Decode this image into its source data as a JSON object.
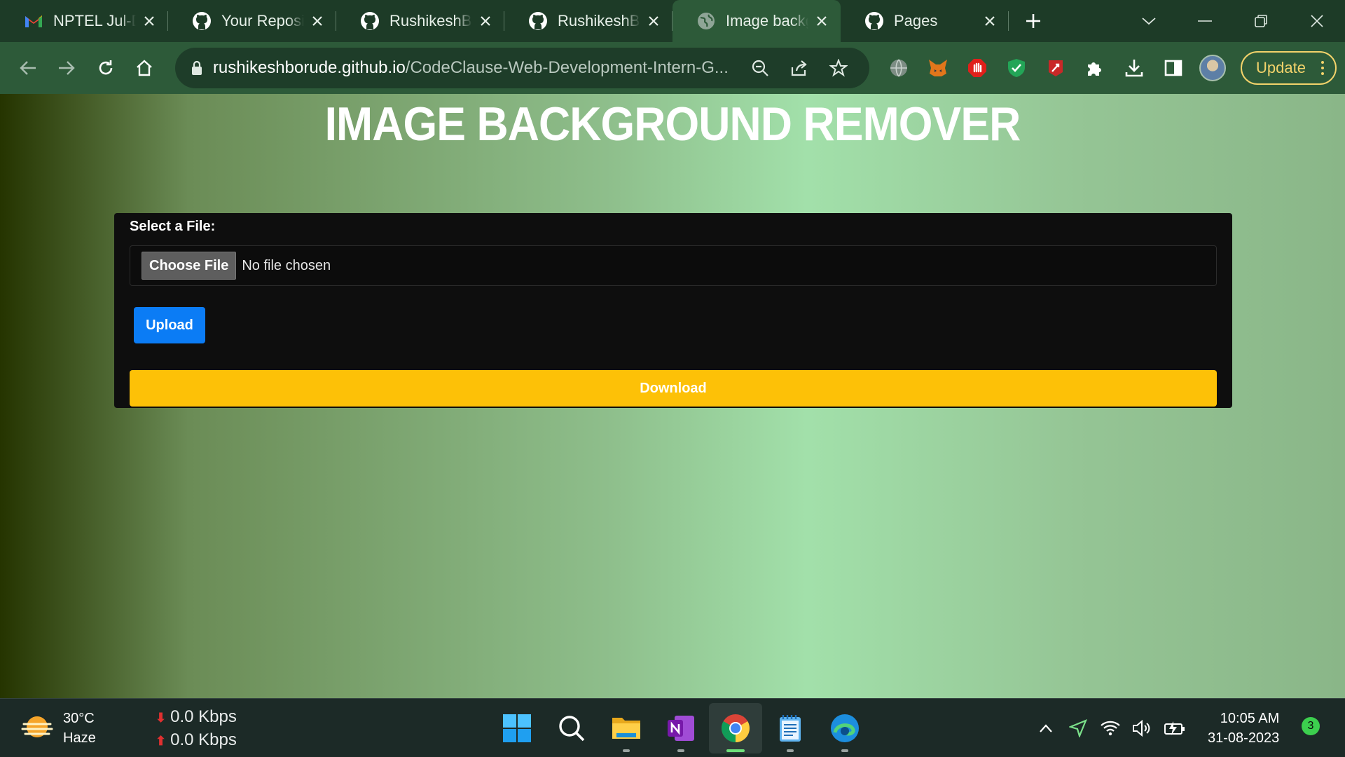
{
  "tabs": [
    {
      "title": "NPTEL Jul-Dec",
      "icon": "gmail-icon",
      "active": false
    },
    {
      "title": "Your Repositories",
      "icon": "github-icon",
      "active": false
    },
    {
      "title": "RushikeshBorude",
      "icon": "github-icon",
      "active": false
    },
    {
      "title": "RushikeshBorude",
      "icon": "github-icon",
      "active": false
    },
    {
      "title": "Image background",
      "icon": "globe-icon",
      "active": true
    },
    {
      "title": "Pages",
      "icon": "github-icon",
      "active": false
    }
  ],
  "toolbar": {
    "url_host": "rushikeshborude.github.io",
    "url_path": "/CodeClause-Web-Development-Intern-G...",
    "update_label": "Update"
  },
  "page": {
    "title": "IMAGE BACKGROUND REMOVER",
    "file_label": "Select a File:",
    "choose_file": "Choose File",
    "no_file": "No file chosen",
    "upload": "Upload",
    "download": "Download"
  },
  "colors": {
    "chrome_frame": "#1d3b27",
    "toolbar": "#2d5a39",
    "upload_button": "#0b7cf5",
    "download_button": "#fdc107"
  },
  "taskbar": {
    "weather_temp": "30°C",
    "weather_desc": "Haze",
    "down_speed": "0.0 Kbps",
    "up_speed": "0.0 Kbps",
    "time": "10:05 AM",
    "date": "31-08-2023",
    "notifications": "3"
  }
}
